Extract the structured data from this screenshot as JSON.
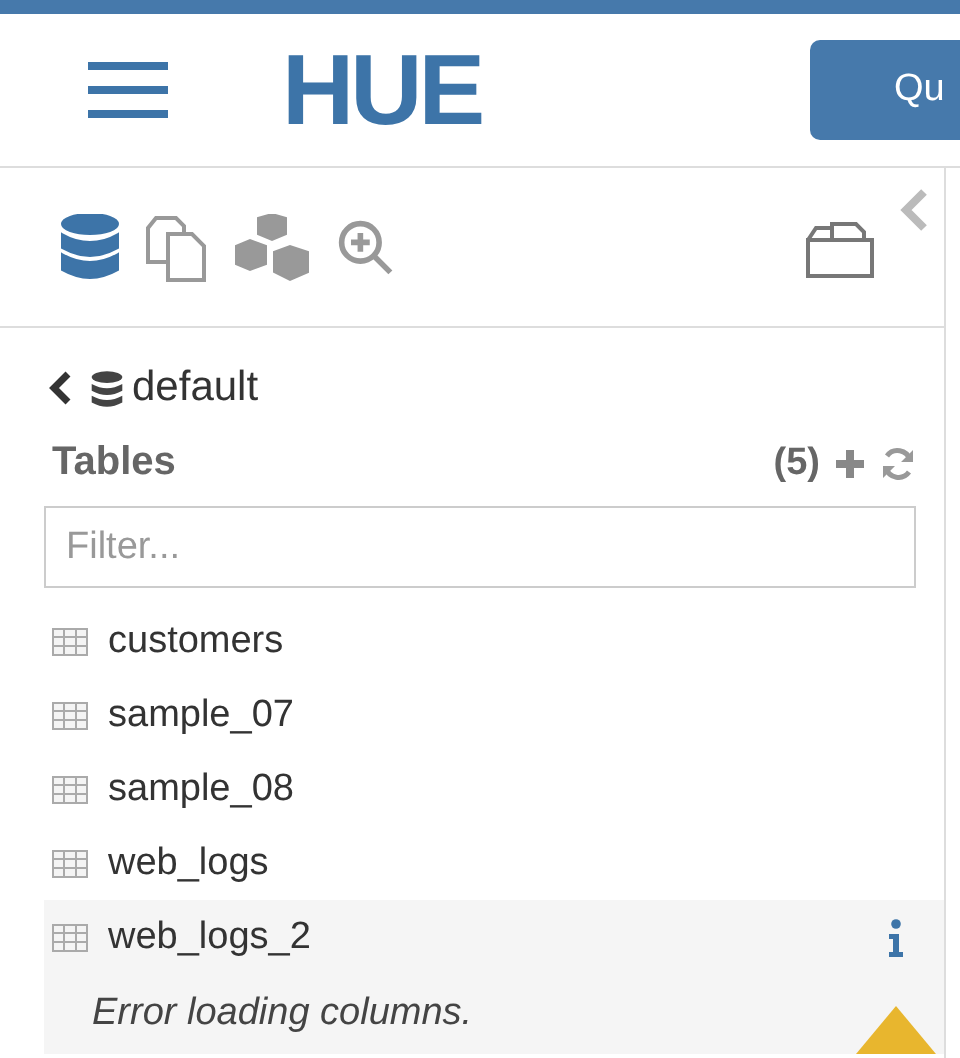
{
  "header": {
    "logo": "HUE",
    "button": "Qu"
  },
  "sidebar": {
    "tabs": [
      {
        "kind": "database",
        "selected": true
      },
      {
        "kind": "documents",
        "selected": false
      },
      {
        "kind": "blocks",
        "selected": false
      },
      {
        "kind": "zoom",
        "selected": false
      }
    ],
    "database": "default",
    "section_title": "Tables",
    "count": "(5)",
    "filter": {
      "placeholder": "Filter..."
    },
    "tables": [
      {
        "name": "customers",
        "selected": false
      },
      {
        "name": "sample_07",
        "selected": false
      },
      {
        "name": "sample_08",
        "selected": false
      },
      {
        "name": "web_logs",
        "selected": false
      },
      {
        "name": "web_logs_2",
        "selected": true,
        "error": "Error loading columns."
      }
    ]
  }
}
